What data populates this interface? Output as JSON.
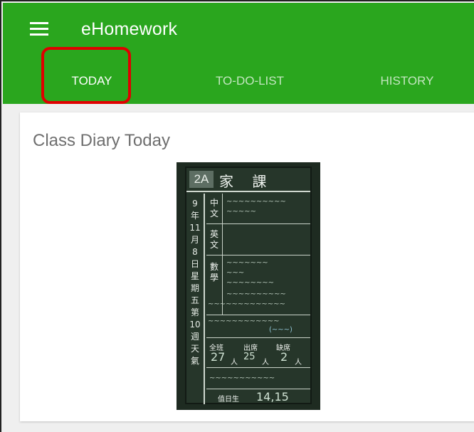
{
  "app": {
    "title": "eHomework",
    "accent_color": "#2aa61e",
    "menu_icon": "hamburger-menu-icon"
  },
  "tabs": [
    {
      "label": "TODAY",
      "active": true
    },
    {
      "label": "TO-DO-LIST",
      "active": false
    },
    {
      "label": "HISTORY",
      "active": false
    }
  ],
  "annotation": {
    "highlight_color": "#e00000",
    "target": "tab-today"
  },
  "card": {
    "title": "Class Diary Today"
  },
  "photo": {
    "class_tag": "2A",
    "heading": "家 課",
    "date_column": [
      "9",
      "年",
      "11",
      "月",
      "8",
      "日",
      "星",
      "期",
      "五",
      "第",
      "10",
      "週",
      "天",
      "氣"
    ],
    "subjects": [
      "中文",
      "英文",
      "數學"
    ],
    "attendance_labels": [
      "全班",
      "出席",
      "缺席"
    ],
    "attendance_values": [
      "27",
      "25",
      "2"
    ],
    "unit": "人",
    "duty_label": "值日生",
    "duty_value": "14,15"
  }
}
